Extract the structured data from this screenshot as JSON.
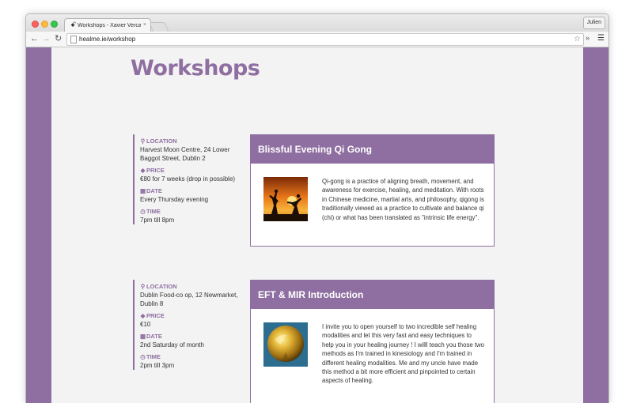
{
  "browser": {
    "tab_title": "Workshops - Xavier Vercaem",
    "tab_close": "×",
    "user_label": "Julien",
    "url": "healme.ie/workshop",
    "nav": {
      "back": "←",
      "forward": "→",
      "reload": "↻"
    },
    "star": "☆",
    "ext": "»",
    "menu": "☰"
  },
  "page": {
    "title": "Workshops",
    "labels": {
      "location": "Location",
      "price": "Price",
      "date": "Date",
      "time": "Time"
    },
    "workshops": [
      {
        "title": "Blissful Evening Qi Gong",
        "location": "Harvest Moon Centre, 24 Lower Baggot Street, Dublin 2",
        "price": "€80 for 7 weeks (drop in possible)",
        "date": "Every Thursday evening",
        "time": "7pm till 8pm",
        "image_icon": "qigong-silhouette-sunset-image",
        "description": "Qi-gong is a practice of aligning breath, movement, and awareness for exercise, healing, and meditation. With roots in Chinese medicine, martial arts, and philosophy, qigong is traditionally viewed as a practice to cultivate and balance qi (chi) or what has been translated as \"intrinsic life energy\"."
      },
      {
        "title": "EFT & MIR Introduction",
        "location": "Dublin Food-co op, 12 Newmarket, Dublin 8",
        "price": "€10",
        "date": "2nd Saturday of month",
        "time": "2pm till 3pm",
        "image_icon": "golden-sphere-image",
        "description": "I invite you to open yourself to two incredible self healing modalities and let this very fast and easy techniques to help you in your healing journey ! I willl teach you those two methods as I'm trained in kinesiology and I'm trained in different healing modalities. Me and my uncle have made this method a bit more efficient and pinpointed to certain aspects of healing."
      }
    ]
  },
  "colors": {
    "accent": "#8f6fa1",
    "page_bg": "#f3f3f3",
    "text": "#333333"
  }
}
